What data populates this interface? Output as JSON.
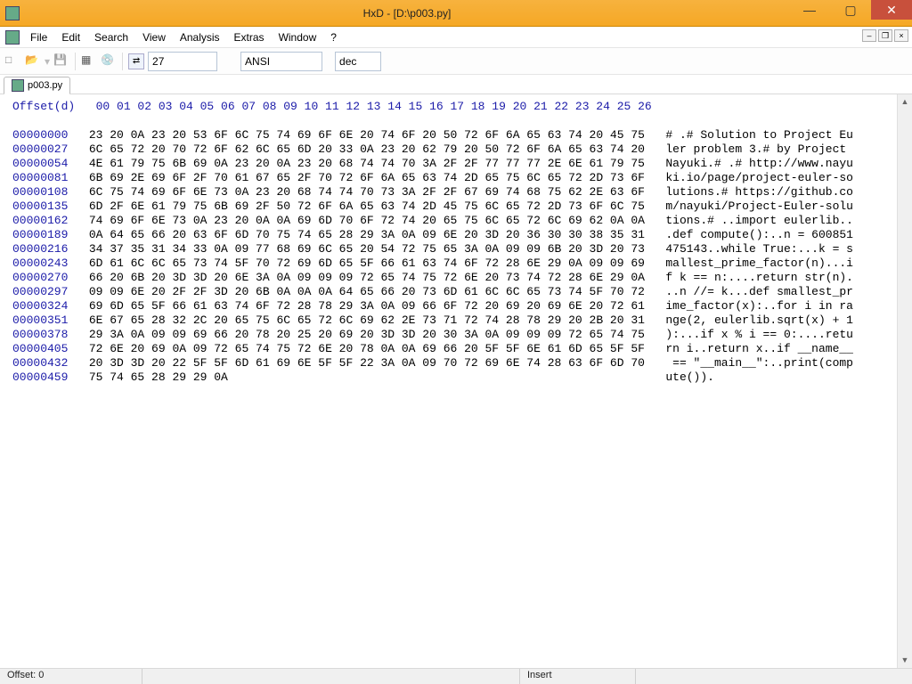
{
  "window": {
    "title": "HxD - [D:\\p003.py]"
  },
  "menu": {
    "items": [
      "File",
      "Edit",
      "Search",
      "View",
      "Analysis",
      "Extras",
      "Window",
      "?"
    ]
  },
  "toolbar": {
    "bytes_per_row": "27",
    "encoding": "ANSI",
    "number_base": "dec"
  },
  "tab": {
    "label": "p003.py"
  },
  "hex": {
    "header_label": "Offset(d)",
    "col_header": "00 01 02 03 04 05 06 07 08 09 10 11 12 13 14 15 16 17 18 19 20 21 22 23 24 25 26",
    "rows": [
      {
        "o": "00000000",
        "h": "23 20 0A 23 20 53 6F 6C 75 74 69 6F 6E 20 74 6F 20 50 72 6F 6A 65 63 74 20 45 75",
        "a": "# .# Solution to Project Eu"
      },
      {
        "o": "00000027",
        "h": "6C 65 72 20 70 72 6F 62 6C 65 6D 20 33 0A 23 20 62 79 20 50 72 6F 6A 65 63 74 20",
        "a": "ler problem 3.# by Project "
      },
      {
        "o": "00000054",
        "h": "4E 61 79 75 6B 69 0A 23 20 0A 23 20 68 74 74 70 3A 2F 2F 77 77 77 2E 6E 61 79 75",
        "a": "Nayuki.# .# http://www.nayu"
      },
      {
        "o": "00000081",
        "h": "6B 69 2E 69 6F 2F 70 61 67 65 2F 70 72 6F 6A 65 63 74 2D 65 75 6C 65 72 2D 73 6F",
        "a": "ki.io/page/project-euler-so"
      },
      {
        "o": "00000108",
        "h": "6C 75 74 69 6F 6E 73 0A 23 20 68 74 74 70 73 3A 2F 2F 67 69 74 68 75 62 2E 63 6F",
        "a": "lutions.# https://github.co"
      },
      {
        "o": "00000135",
        "h": "6D 2F 6E 61 79 75 6B 69 2F 50 72 6F 6A 65 63 74 2D 45 75 6C 65 72 2D 73 6F 6C 75",
        "a": "m/nayuki/Project-Euler-solu"
      },
      {
        "o": "00000162",
        "h": "74 69 6F 6E 73 0A 23 20 0A 0A 69 6D 70 6F 72 74 20 65 75 6C 65 72 6C 69 62 0A 0A",
        "a": "tions.# ..import eulerlib.."
      },
      {
        "o": "00000189",
        "h": "0A 64 65 66 20 63 6F 6D 70 75 74 65 28 29 3A 0A 09 6E 20 3D 20 36 30 30 38 35 31",
        "a": ".def compute():..n = 600851"
      },
      {
        "o": "00000216",
        "h": "34 37 35 31 34 33 0A 09 77 68 69 6C 65 20 54 72 75 65 3A 0A 09 09 6B 20 3D 20 73",
        "a": "475143..while True:...k = s"
      },
      {
        "o": "00000243",
        "h": "6D 61 6C 6C 65 73 74 5F 70 72 69 6D 65 5F 66 61 63 74 6F 72 28 6E 29 0A 09 09 69",
        "a": "mallest_prime_factor(n)...i"
      },
      {
        "o": "00000270",
        "h": "66 20 6B 20 3D 3D 20 6E 3A 0A 09 09 09 72 65 74 75 72 6E 20 73 74 72 28 6E 29 0A",
        "a": "f k == n:....return str(n)."
      },
      {
        "o": "00000297",
        "h": "09 09 6E 20 2F 2F 3D 20 6B 0A 0A 0A 64 65 66 20 73 6D 61 6C 6C 65 73 74 5F 70 72",
        "a": "..n //= k...def smallest_pr"
      },
      {
        "o": "00000324",
        "h": "69 6D 65 5F 66 61 63 74 6F 72 28 78 29 3A 0A 09 66 6F 72 20 69 20 69 6E 20 72 61",
        "a": "ime_factor(x):..for i in ra"
      },
      {
        "o": "00000351",
        "h": "6E 67 65 28 32 2C 20 65 75 6C 65 72 6C 69 62 2E 73 71 72 74 28 78 29 20 2B 20 31",
        "a": "nge(2, eulerlib.sqrt(x) + 1"
      },
      {
        "o": "00000378",
        "h": "29 3A 0A 09 09 69 66 20 78 20 25 20 69 20 3D 3D 20 30 3A 0A 09 09 09 72 65 74 75",
        "a": "):...if x % i == 0:....retu"
      },
      {
        "o": "00000405",
        "h": "72 6E 20 69 0A 09 72 65 74 75 72 6E 20 78 0A 0A 69 66 20 5F 5F 6E 61 6D 65 5F 5F",
        "a": "rn i..return x..if __name__"
      },
      {
        "o": "00000432",
        "h": "20 3D 3D 20 22 5F 5F 6D 61 69 6E 5F 5F 22 3A 0A 09 70 72 69 6E 74 28 63 6F 6D 70",
        "a": " == \"__main__\":..print(comp"
      },
      {
        "o": "00000459",
        "h": "75 74 65 28 29 29 0A",
        "a": "ute())."
      }
    ]
  },
  "status": {
    "offset_label": "Offset: 0",
    "mode": "Insert"
  }
}
